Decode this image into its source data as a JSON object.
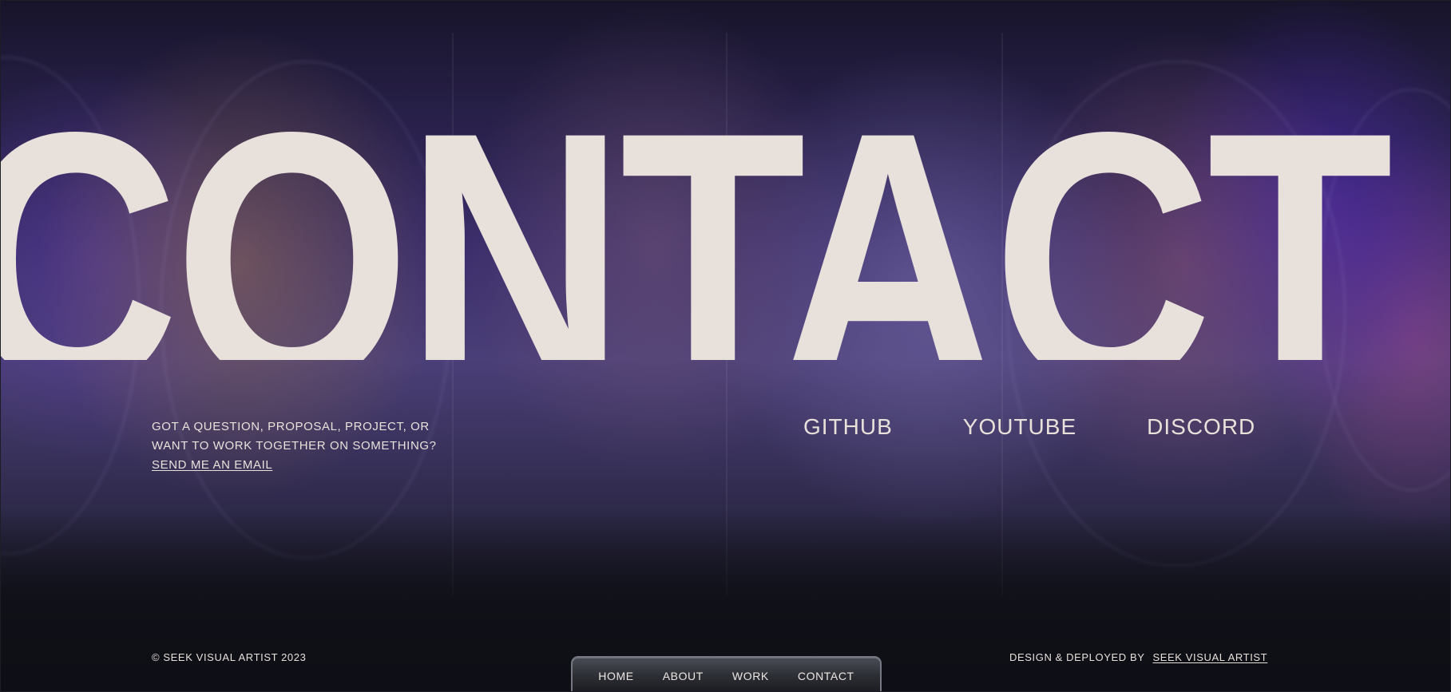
{
  "hero": {
    "title": "CONTACT"
  },
  "contact_intro": {
    "line1": "GOT A QUESTION, PROPOSAL, PROJECT, OR",
    "line2": "WANT TO WORK TOGETHER ON SOMETHING?",
    "email_link": "SEND ME AN EMAIL"
  },
  "social_links": [
    {
      "label": "GITHUB"
    },
    {
      "label": "YOUTUBE"
    },
    {
      "label": "DISCORD"
    }
  ],
  "footer": {
    "copyright": "© SEEK VISUAL ARTIST 2023",
    "credit_prefix": "DESIGN & DEPLOYED BY",
    "credit_link": "SEEK VISUAL ARTIST"
  },
  "nav": {
    "items": [
      {
        "label": "HOME"
      },
      {
        "label": "ABOUT"
      },
      {
        "label": "WORK"
      },
      {
        "label": "CONTACT"
      }
    ]
  },
  "colors": {
    "text": "#e8e1da",
    "background": "#13121d",
    "accent_purple": "#4b3f78",
    "nav_border": "#767983"
  }
}
